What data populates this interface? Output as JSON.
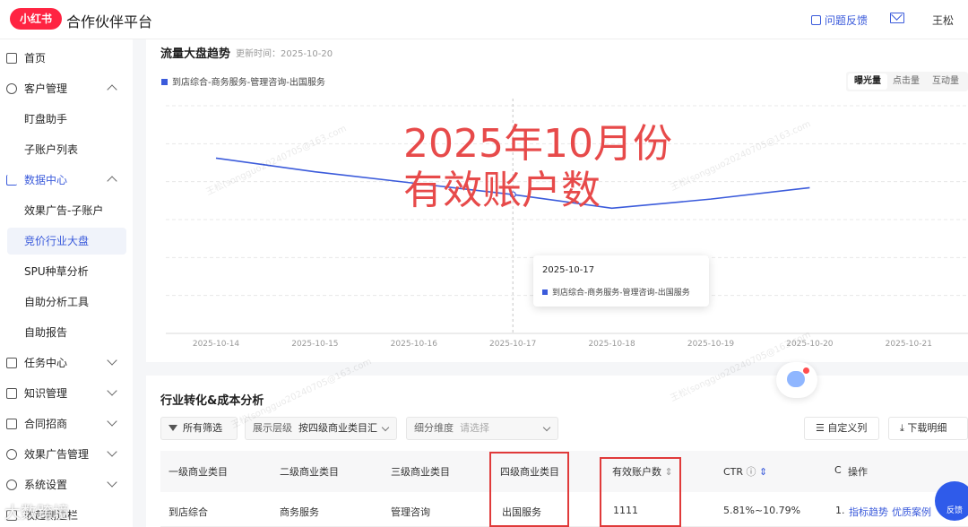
{
  "header": {
    "logo": "小红书",
    "title": "合作伙伴平台",
    "feedback": "问题反馈",
    "user": "王松"
  },
  "sidebar": {
    "items": [
      {
        "label": "首页"
      },
      {
        "label": "客户管理"
      },
      {
        "label": "盯盘助手"
      },
      {
        "label": "子账户列表"
      },
      {
        "label": "数据中心"
      },
      {
        "label": "效果广告-子账户"
      },
      {
        "label": "竞价行业大盘"
      },
      {
        "label": "SPU种草分析"
      },
      {
        "label": "自助分析工具"
      },
      {
        "label": "自助报告"
      },
      {
        "label": "任务中心"
      },
      {
        "label": "知识管理"
      },
      {
        "label": "合同招商"
      },
      {
        "label": "效果广告管理"
      },
      {
        "label": "系统设置"
      },
      {
        "label": "收起侧边栏"
      }
    ]
  },
  "trend": {
    "title": "流量大盘趋势",
    "update_time": "更新时间：2025-10-20",
    "legend": "到店综合-商务服务-管理咨询-出国服务",
    "metric_tabs": [
      "曝光量",
      "点击量",
      "互动量"
    ],
    "tooltip_date": "2025-10-17",
    "tooltip_series": "到店综合-商务服务-管理咨询-出国服务"
  },
  "overlay": {
    "line1": "2025年10月份",
    "line2": "有效账户数"
  },
  "chart_data": {
    "type": "line",
    "categories": [
      "2025-10-14",
      "2025-10-15",
      "2025-10-16",
      "2025-10-17",
      "2025-10-18",
      "2025-10-19",
      "2025-10-20",
      "2025-10-21"
    ],
    "series": [
      {
        "name": "到店综合-商务服务-管理咨询-出国服务",
        "values": [
          0.77,
          0.71,
          0.66,
          0.61,
          0.55,
          0.59,
          0.64,
          null
        ]
      }
    ],
    "ylim": [
      0,
      1
    ],
    "grid": true,
    "legend_position": "top-left",
    "active_category": "2025-10-17"
  },
  "analysis": {
    "title": "行业转化&成本分析",
    "all_filters": "所有筛选",
    "level_label": "展示层级",
    "level_value": "按四级商业类目汇",
    "dim_label": "细分维度",
    "dim_placeholder": "请选择",
    "custom_cols": "自定义列",
    "download": "下载明细",
    "columns": [
      "一级商业类目",
      "二级商业类目",
      "三级商业类目",
      "四级商业类目",
      "有效账户数",
      "CTR",
      "C",
      "操作"
    ],
    "rows": [
      {
        "c1": "到店综合",
        "c2": "商务服务",
        "c3": "管理咨询",
        "c4": "出国服务",
        "accounts": "1111",
        "ctr": "5.81%~10.79%",
        "c": "1.",
        "action1": "指标趋势",
        "action2": "优质案例"
      }
    ]
  },
  "floating": {
    "feedback_fab": "反馈",
    "bottom_watermark": "大数跨境"
  },
  "watermark_text": "王松(songguo20240705@163.com",
  "colors": {
    "brand": "#ff2442",
    "accent": "#3b5bdb",
    "annotation": "#e74a4a"
  }
}
